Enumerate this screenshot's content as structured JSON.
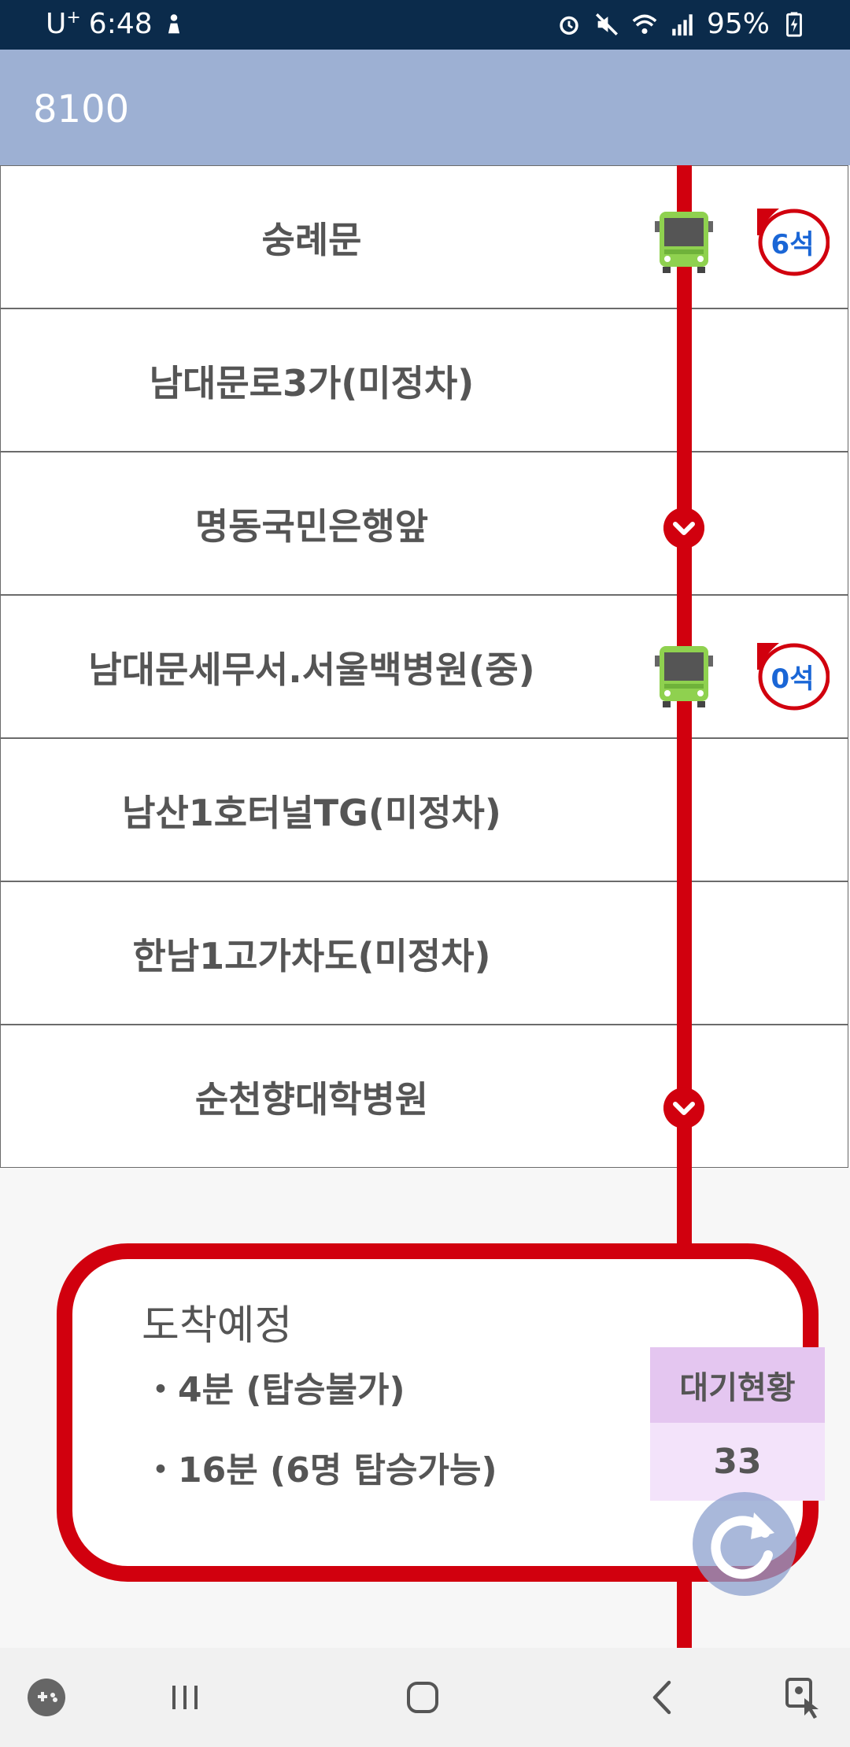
{
  "status_bar": {
    "carrier": "U",
    "carrier_sup": "+",
    "time": "6:48",
    "battery": "95%",
    "icons": [
      "person-icon",
      "alarm-icon",
      "mute-icon",
      "wifi-icon",
      "signal-icon",
      "battery-icon"
    ]
  },
  "app_bar": {
    "title": "8100"
  },
  "stops": [
    {
      "name": "숭례문"
    },
    {
      "name": "남대문로3가(미정차)"
    },
    {
      "name": "명동국민은행앞"
    },
    {
      "name": "남대문세무서.서울백병원(중)"
    },
    {
      "name": "남산1호터널TG(미정차)"
    },
    {
      "name": "한남1고가차도(미정차)"
    },
    {
      "name": "순천향대학병원"
    }
  ],
  "buses": [
    {
      "stop_index": 0,
      "seats": "6석"
    },
    {
      "stop_index": 3,
      "seats": "0석"
    }
  ],
  "arrival": {
    "heading": "도착예정",
    "lines": [
      "・4분 (탑승불가)",
      "・16분 (6명 탑승가능)"
    ],
    "wait_label": "대기현황",
    "wait_value": "33"
  },
  "colors": {
    "route_red": "#d1000e",
    "app_bar": "#9db0d3",
    "status_bar": "#0b2b4b",
    "bus_green": "#8fd14f",
    "seat_text": "#1a66d6"
  },
  "nav_icons": [
    "game-launcher-icon",
    "recent-apps-icon",
    "home-icon",
    "back-icon",
    "touch-assist-icon"
  ]
}
